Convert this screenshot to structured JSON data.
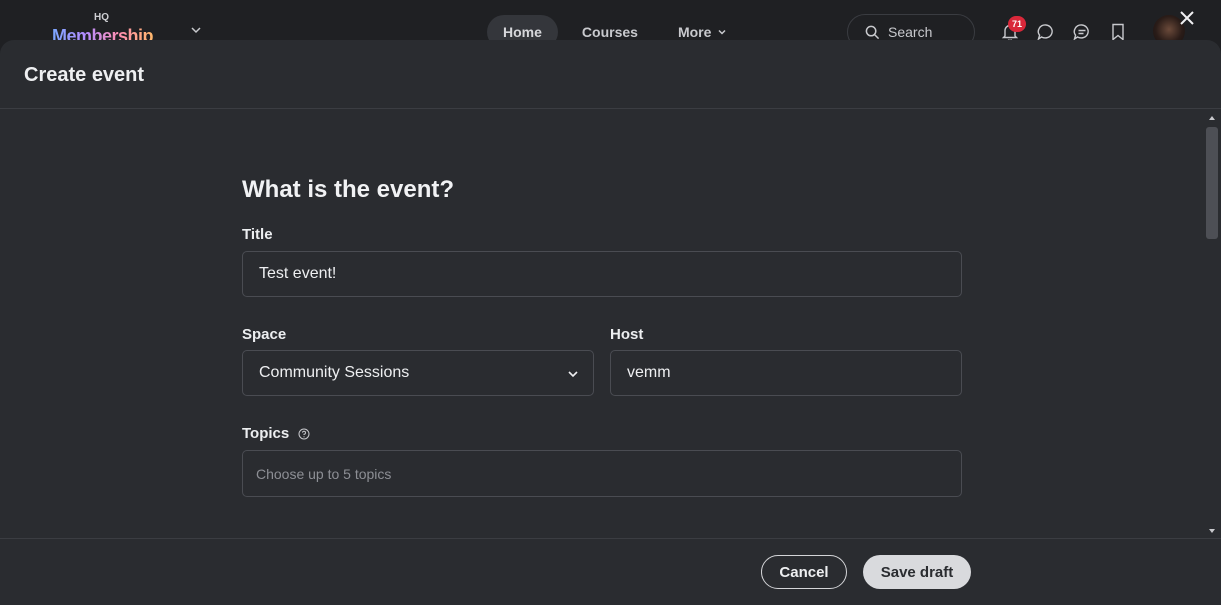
{
  "topnav": {
    "logo_small": "HQ",
    "logo_word": "Membership",
    "tabs": [
      {
        "label": "Home"
      },
      {
        "label": "Courses"
      },
      {
        "label": "More"
      }
    ],
    "search_label": "Search",
    "notification_count": "71"
  },
  "modal": {
    "title": "Create event",
    "section_heading": "What is the event?",
    "title_label": "Title",
    "title_value": "Test event!",
    "space_label": "Space",
    "space_value": "Community Sessions",
    "host_label": "Host",
    "host_value": "vemm",
    "topics_label": "Topics",
    "topics_placeholder": "Choose up to 5 topics"
  },
  "footer": {
    "cancel_label": "Cancel",
    "save_label": "Save draft"
  },
  "colors": {
    "background": "#1f2023",
    "modal": "#2a2c30",
    "badge": "#d9283a"
  }
}
